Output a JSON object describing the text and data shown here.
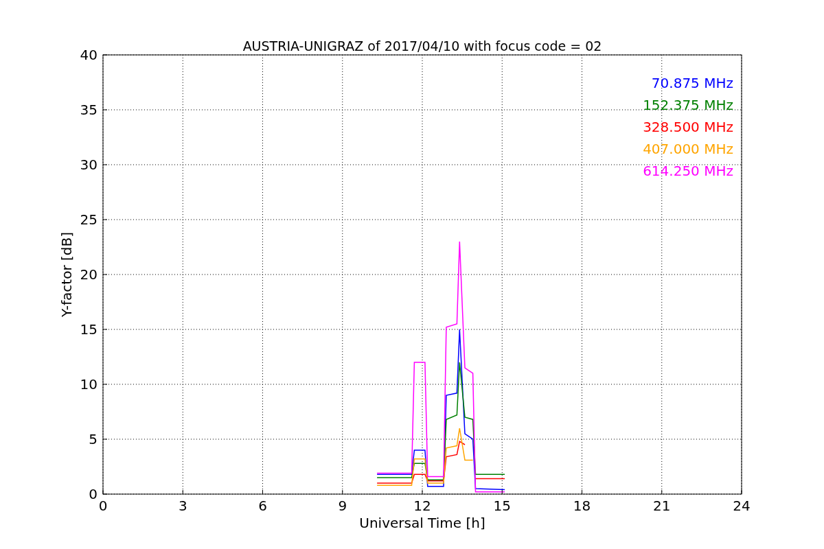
{
  "chart_data": {
    "type": "line",
    "title": "AUSTRIA-UNIGRAZ of 2017/04/10 with focus code = 02",
    "xlabel": "Universal Time [h]",
    "ylabel": "Y-factor [dB]",
    "x": [
      10.3,
      11.6,
      11.7,
      12.1,
      12.2,
      12.8,
      12.9,
      13.3,
      13.4,
      13.6,
      13.9,
      14.0,
      15.1
    ],
    "series": [
      {
        "name": "70.875 MHz",
        "color": "#0000ff",
        "values": [
          1.8,
          1.8,
          4,
          4,
          0.7,
          0.7,
          9,
          9.2,
          15,
          5.5,
          5,
          0.5,
          0.4
        ]
      },
      {
        "name": "152.375 MHz",
        "color": "#008000",
        "values": [
          1.5,
          1.5,
          2.8,
          2.8,
          1.3,
          1.3,
          6.8,
          7.2,
          12,
          7,
          6.8,
          1.8,
          1.8
        ]
      },
      {
        "name": "328.500 MHz",
        "color": "#ff0000",
        "values": [
          1,
          1,
          1.8,
          1.8,
          1.2,
          1.2,
          3.4,
          3.6,
          4.8,
          4.5,
          null,
          1.4,
          1.4
        ]
      },
      {
        "name": "407.000 MHz",
        "color": "#ffa500",
        "values": [
          0.8,
          0.8,
          3.2,
          3.2,
          1,
          1,
          4.2,
          4.4,
          6,
          3.1,
          3.1,
          null,
          null
        ]
      },
      {
        "name": "614.250 MHz",
        "color": "#ff00ff",
        "values": [
          1.9,
          1.9,
          12,
          12,
          1.6,
          1.6,
          15.2,
          15.5,
          23,
          11.5,
          11,
          0.2,
          0.2
        ]
      }
    ],
    "grid": true,
    "xlim": [
      0,
      24
    ],
    "ylim": [
      0,
      40
    ],
    "xticks": [
      0,
      3,
      6,
      9,
      12,
      15,
      18,
      21,
      24
    ],
    "yticks": [
      0,
      5,
      10,
      15,
      20,
      25,
      30,
      35,
      40
    ]
  }
}
